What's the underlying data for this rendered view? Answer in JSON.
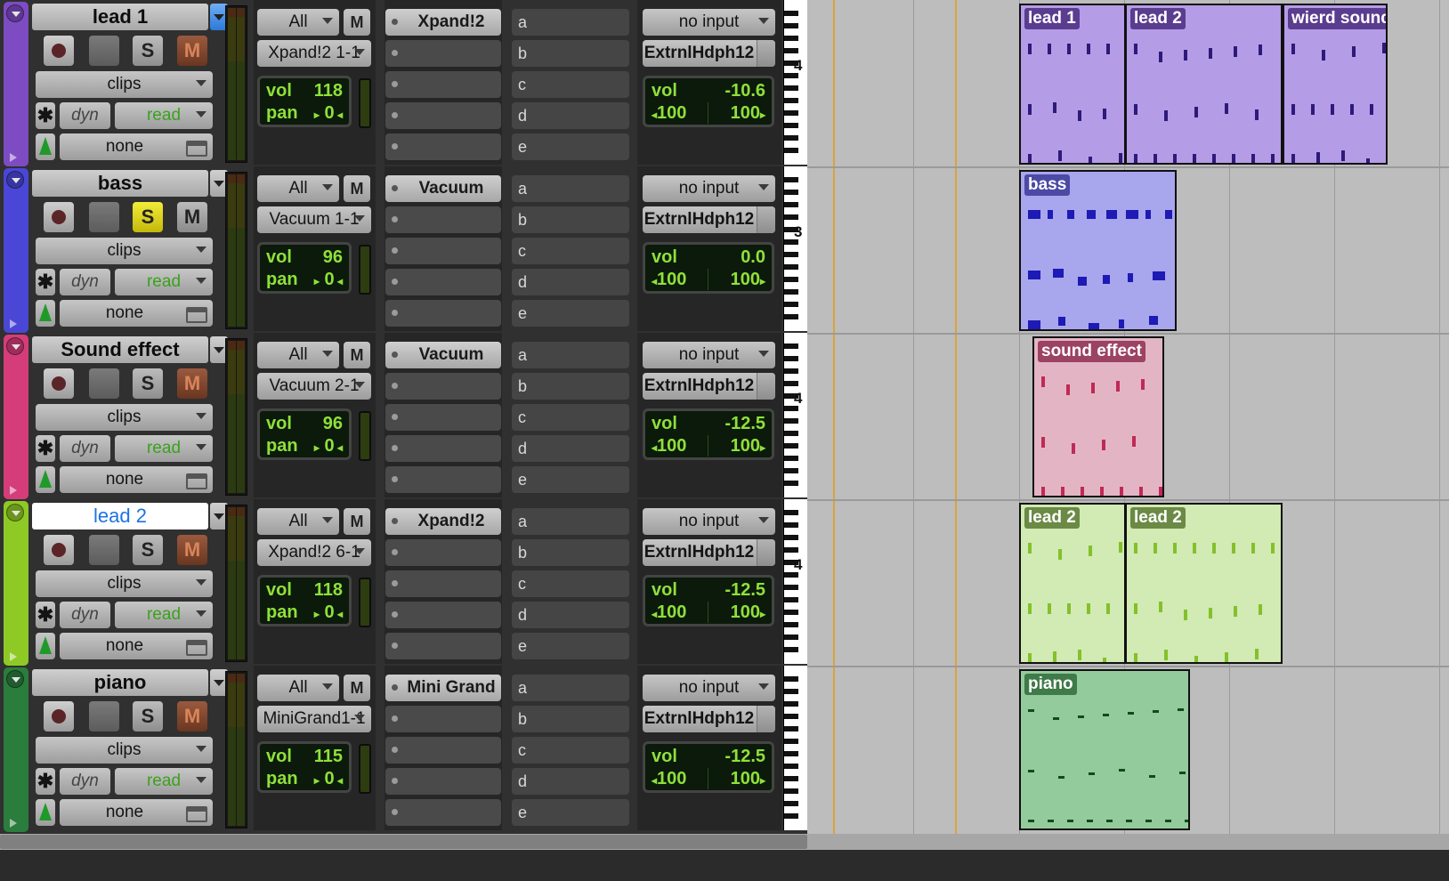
{
  "tracks": [
    {
      "name": "lead 1",
      "color": "#7d4bc2",
      "selected": false,
      "menu_active": true,
      "solo_on": false,
      "mute_on": true,
      "group": "All",
      "mute_label": "M",
      "instrument": "Xpand!2 1-1",
      "vol_label": "vol",
      "vol": "118",
      "pan_label": "pan",
      "pan": "0",
      "insert": "Xpand!2",
      "sends": [
        "a",
        "b",
        "c",
        "d",
        "e"
      ],
      "input": "no input",
      "output": "ExtrnlHdph12",
      "out_vol": "-10.6",
      "pan_l": "100",
      "pan_r": "100",
      "record_label": "",
      "solo_label": "S",
      "clips_label": "clips",
      "dyn_label": "dyn",
      "read_label": "read",
      "none_label": "none",
      "ruler_num": "4"
    },
    {
      "name": "bass",
      "color": "#4a47d6",
      "selected": false,
      "menu_active": false,
      "solo_on": true,
      "mute_on": false,
      "group": "All",
      "mute_label": "M",
      "instrument": "Vacuum 1-1",
      "vol_label": "vol",
      "vol": "96",
      "pan_label": "pan",
      "pan": "0",
      "insert": "Vacuum",
      "sends": [
        "a",
        "b",
        "c",
        "d",
        "e"
      ],
      "input": "no input",
      "output": "ExtrnlHdph12",
      "out_vol": "0.0",
      "pan_l": "100",
      "pan_r": "100",
      "solo_label": "S",
      "clips_label": "clips",
      "dyn_label": "dyn",
      "read_label": "read",
      "none_label": "none",
      "ruler_num": "3"
    },
    {
      "name": "Sound effect",
      "color": "#d43d7a",
      "selected": false,
      "menu_active": false,
      "solo_on": false,
      "mute_on": true,
      "group": "All",
      "mute_label": "M",
      "instrument": "Vacuum 2-1",
      "vol_label": "vol",
      "vol": "96",
      "pan_label": "pan",
      "pan": "0",
      "insert": "Vacuum",
      "sends": [
        "a",
        "b",
        "c",
        "d",
        "e"
      ],
      "input": "no input",
      "output": "ExtrnlHdph12",
      "out_vol": "-12.5",
      "pan_l": "100",
      "pan_r": "100",
      "solo_label": "S",
      "clips_label": "clips",
      "dyn_label": "dyn",
      "read_label": "read",
      "none_label": "none",
      "ruler_num": "4"
    },
    {
      "name": "lead 2",
      "color": "#8ec926",
      "selected": true,
      "menu_active": false,
      "solo_on": false,
      "mute_on": true,
      "group": "All",
      "mute_label": "M",
      "instrument": "Xpand!2 6-1",
      "vol_label": "vol",
      "vol": "118",
      "pan_label": "pan",
      "pan": "0",
      "insert": "Xpand!2",
      "sends": [
        "a",
        "b",
        "c",
        "d",
        "e"
      ],
      "input": "no input",
      "output": "ExtrnlHdph12",
      "out_vol": "-12.5",
      "pan_l": "100",
      "pan_r": "100",
      "solo_label": "S",
      "clips_label": "clips",
      "dyn_label": "dyn",
      "read_label": "read",
      "none_label": "none",
      "ruler_num": "4"
    },
    {
      "name": "piano",
      "color": "#2a7d3c",
      "selected": false,
      "menu_active": false,
      "solo_on": false,
      "mute_on": true,
      "group": "All",
      "mute_label": "M",
      "instrument": "MiniGrand1-1",
      "vol_label": "vol",
      "vol": "115",
      "pan_label": "pan",
      "pan": "0",
      "insert": "Mini Grand",
      "sends": [
        "a",
        "b",
        "c",
        "d",
        "e"
      ],
      "input": "no input",
      "output": "ExtrnlHdph12",
      "out_vol": "-12.5",
      "pan_l": "100",
      "pan_r": "100",
      "solo_label": "S",
      "clips_label": "clips",
      "dyn_label": "dyn",
      "read_label": "read",
      "none_label": "none",
      "ruler_num": ""
    }
  ],
  "clips": [
    {
      "label": "lead 1",
      "track": 0,
      "fill": "#b59ce6",
      "note": "#2d1a7a",
      "labelbg": "#5b3d8f"
    },
    {
      "label": "lead 2",
      "track": 0,
      "fill": "#b59ce6",
      "note": "#2d1a7a",
      "labelbg": "#5b3d8f"
    },
    {
      "label": "wierd sound",
      "track": 0,
      "fill": "#b59ce6",
      "note": "#2d1a7a",
      "labelbg": "#5b3d8f"
    },
    {
      "label": "bass",
      "track": 1,
      "fill": "#a8a6ec",
      "note": "#1d1ab5",
      "labelbg": "#4c4aa5"
    },
    {
      "label": "sound effect",
      "track": 2,
      "fill": "#e3b5c4",
      "note": "#c02956",
      "labelbg": "#9c4262"
    },
    {
      "label": "lead 2",
      "track": 3,
      "fill": "#d2eab4",
      "note": "#83c12a",
      "labelbg": "#6b8a45"
    },
    {
      "label": "lead 2",
      "track": 3,
      "fill": "#d2eab4",
      "note": "#83c12a",
      "labelbg": "#6b8a45"
    },
    {
      "label": "piano",
      "track": 4,
      "fill": "#93cb9c",
      "note": "#114a1c",
      "labelbg": "#3f7a49"
    }
  ]
}
